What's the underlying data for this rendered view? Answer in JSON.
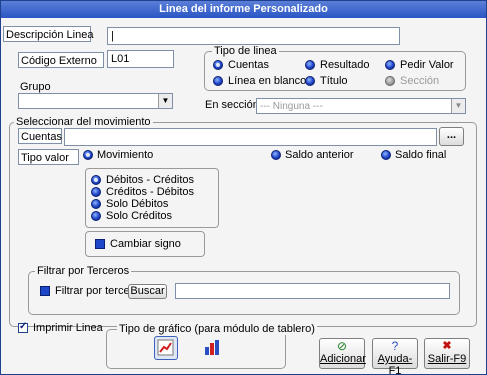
{
  "window": {
    "title": "Linea del informe Personalizado"
  },
  "form": {
    "descripcion_label": "Descripción Linea",
    "descripcion_value": "|",
    "codigo_label": "Código Externo",
    "codigo_value": "L01",
    "grupo_label": "Grupo",
    "grupo_value": ""
  },
  "tipo_linea": {
    "title": "Tipo de linea",
    "options": [
      "Cuentas",
      "Resultado",
      "Pedir Valor",
      "Línea en blanco",
      "Título",
      "Sección"
    ],
    "selected": "Cuentas"
  },
  "en_seccion": {
    "label": "En sección",
    "value": "--- Ninguna ---"
  },
  "seleccionar": {
    "title": "Seleccionar del movimiento",
    "cuentas_label": "Cuentas",
    "cuentas_value": "",
    "browse_label": "...",
    "tipo_valor_label": "Tipo valor",
    "tipo_valor_options": [
      "Movimiento",
      "Saldo anterior",
      "Saldo final"
    ],
    "tipo_valor_selected": "Movimiento",
    "movimiento_options": [
      "Débitos - Créditos",
      "Créditos - Débitos",
      "Solo Débitos",
      "Solo Créditos"
    ],
    "movimiento_selected": "Débitos - Créditos",
    "cambiar_signo_label": "Cambiar signo"
  },
  "terceros": {
    "title": "Filtrar por Terceros",
    "check_label": "Filtrar por terceros",
    "buscar_label": "Buscar",
    "value": ""
  },
  "imprimir": {
    "label": "Imprimir Linea",
    "checked": true
  },
  "grafico": {
    "title": "Tipo de gráfico  (para módulo de tablero)"
  },
  "buttons": {
    "adicionar": "Adicionar",
    "ayuda": "Ayuda-F1",
    "salir": "Salir-F9"
  }
}
